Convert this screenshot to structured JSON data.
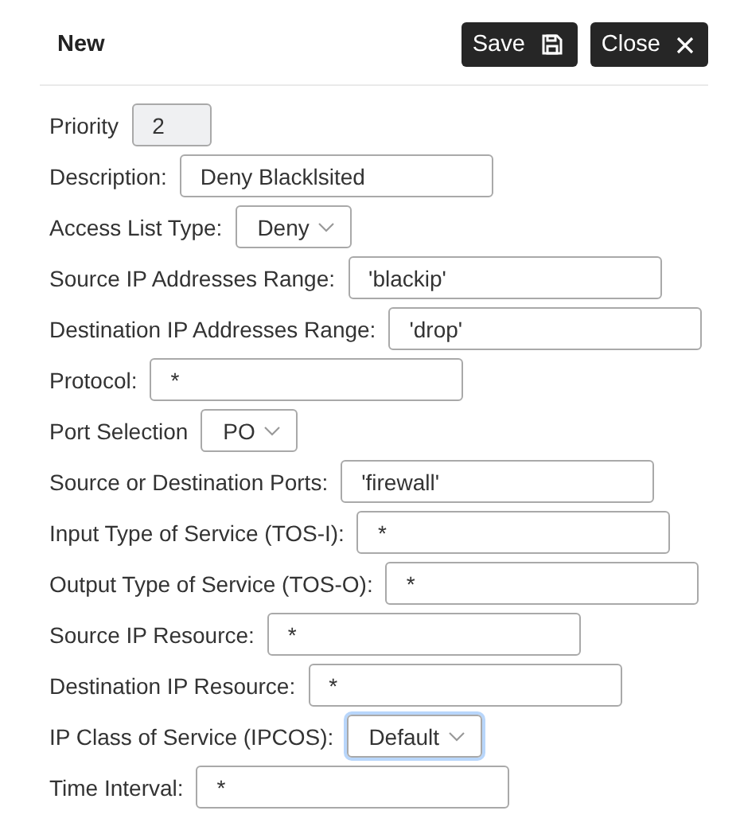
{
  "header": {
    "title": "New",
    "buttons": [
      {
        "label": "Save",
        "kind": "save"
      },
      {
        "label": "Close",
        "kind": "close"
      }
    ]
  },
  "fields": [
    {
      "label": "Priority",
      "kind": "readonly",
      "value": "2"
    },
    {
      "label": "Description:",
      "kind": "text",
      "value": "Deny Blacklsited"
    },
    {
      "label": "Access List Type:",
      "kind": "select",
      "value": "Deny",
      "focused": false
    },
    {
      "label": "Source IP Addresses Range:",
      "kind": "text",
      "value": "'blackip'"
    },
    {
      "label": "Destination IP Addresses Range:",
      "kind": "text",
      "value": "'drop'"
    },
    {
      "label": "Protocol:",
      "kind": "text",
      "value": "*"
    },
    {
      "label": "Port Selection",
      "kind": "select",
      "value": "PO",
      "focused": false
    },
    {
      "label": "Source or Destination Ports:",
      "kind": "text",
      "value": "'firewall'"
    },
    {
      "label": "Input Type of Service (TOS-I):",
      "kind": "text",
      "value": "*"
    },
    {
      "label": "Output Type of Service (TOS-O):",
      "kind": "text",
      "value": "*"
    },
    {
      "label": "Source IP Resource:",
      "kind": "text",
      "value": "*"
    },
    {
      "label": "Destination IP Resource:",
      "kind": "text",
      "value": "*"
    },
    {
      "label": "IP Class of Service (IPCOS):",
      "kind": "select",
      "value": "Default",
      "focused": true
    },
    {
      "label": "Time Interval:",
      "kind": "text",
      "value": "*"
    }
  ]
}
